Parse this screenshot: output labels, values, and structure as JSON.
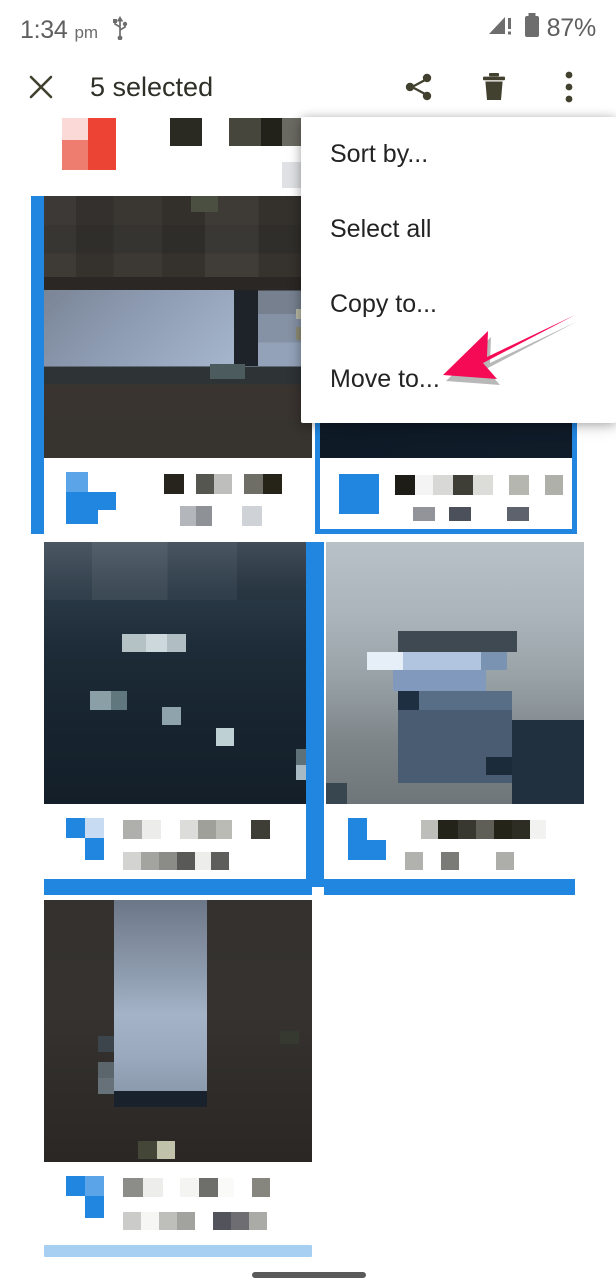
{
  "status_bar": {
    "time": "1:34",
    "ampm": "pm",
    "usb_icon": "usb-icon",
    "signal_icon": "signal-warning-icon",
    "battery_icon": "battery-icon",
    "battery_text": "87%"
  },
  "app_bar": {
    "close_icon": "close-icon",
    "title": "5 selected",
    "share_icon": "share-icon",
    "delete_icon": "trash-icon",
    "overflow_icon": "more-vertical-icon"
  },
  "overflow_menu": {
    "items": [
      {
        "label": "Sort by..."
      },
      {
        "label": "Select all"
      },
      {
        "label": "Copy to..."
      },
      {
        "label": "Move to..."
      }
    ]
  },
  "annotation": {
    "arrow_name": "pointer-arrow",
    "arrow_color": "#F50A56",
    "points_at": "Move to..."
  },
  "colors": {
    "selection_blue": "#2086E0",
    "progress_blue": "#A7CFF2",
    "icon_gray": "#42412f",
    "status_gray": "#5f5f5f"
  },
  "grid": {
    "selected_count": 5,
    "columns": 2,
    "items": [
      {
        "name": "grid-item-partial-top",
        "selected": false,
        "row": 0,
        "col": 0
      },
      {
        "name": "grid-item-1",
        "selected": true,
        "row": 1,
        "col": 0
      },
      {
        "name": "grid-item-2",
        "selected": true,
        "row": 1,
        "col": 1
      },
      {
        "name": "grid-item-3",
        "selected": true,
        "row": 2,
        "col": 0
      },
      {
        "name": "grid-item-4",
        "selected": true,
        "row": 2,
        "col": 1
      },
      {
        "name": "grid-item-5",
        "selected": true,
        "row": 3,
        "col": 0
      }
    ]
  },
  "bottom": {
    "progress_bar": "loading-progress-bar",
    "home_indicator": "home-indicator"
  }
}
